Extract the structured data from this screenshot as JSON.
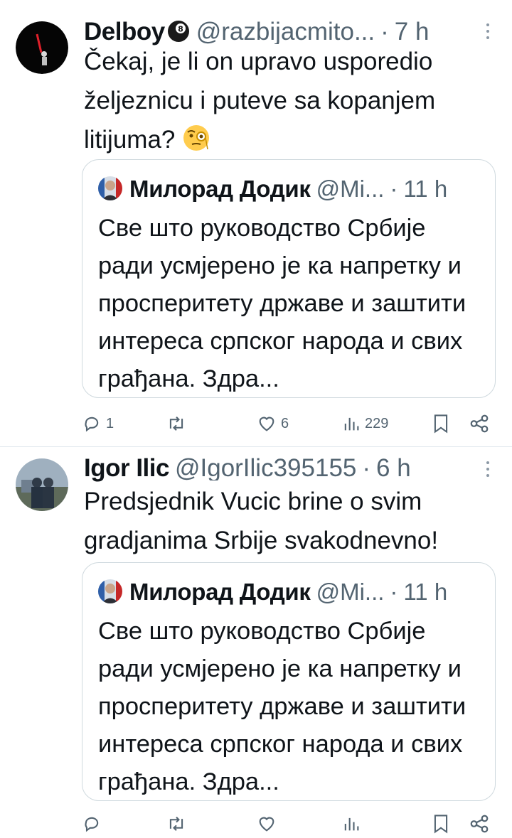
{
  "tweets": [
    {
      "author": "Delboy",
      "handle": "@razbijacmito...",
      "dot": "·",
      "time": "7 h",
      "text": "Čekaj, je li on upravo usporedio željeznicu i puteve sa kopanjem litijuma?",
      "emoji": "face-with-monocle-icon",
      "quote": {
        "author": "Милорад Додик",
        "handle": "@Mi...",
        "dot": "·",
        "time": "11 h",
        "text": "Све што руководство Србије ради усмјерено је ка напретку и просперитету државе и заштити интереса српског народа и свих грађана. Здра..."
      },
      "actions": {
        "replies": "1",
        "retweets": "",
        "likes": "6",
        "views": "229"
      }
    },
    {
      "author": "Igor Ilic",
      "handle": "@IgorIlic395155",
      "dot": "·",
      "time": "6 h",
      "text": "Predsjednik Vucic brine o svim gradjanima Srbije svakodnevno!",
      "quote": {
        "author": "Милорад Додик",
        "handle": "@Mi...",
        "dot": "·",
        "time": "11 h",
        "text": "Све што руководство Србије ради усмјерено је ка напретку и просперитету државе и заштити интереса српског народа и свих грађана. Здра..."
      }
    }
  ],
  "colors": {
    "secondary_text": "#536471",
    "border": "#cfd9de",
    "primary_text": "#0f1419"
  }
}
